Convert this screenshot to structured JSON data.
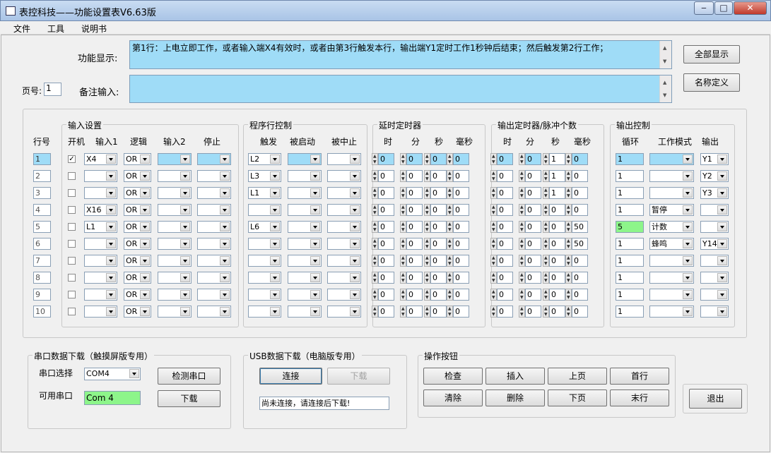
{
  "window": {
    "title": "表控科技——功能设置表V6.63版",
    "min": "‒",
    "max": "□",
    "close": "✕"
  },
  "menu": [
    "文件",
    "工具",
    "说明书"
  ],
  "function_label": "功能显示:",
  "function_text": "第1行：上电立即工作，或者输入端X4有效时，或者由第3行触发本行，输出端Y1定时工作1秒钟后结束；然后触发第2行工作；",
  "page_label": "页号:",
  "page_value": "1",
  "remark_label": "备注输入:",
  "remark_text": "",
  "buttons_right": {
    "show_all": "全部显示",
    "name_def": "名称定义",
    "exit": "退出"
  },
  "groups": {
    "input": "输入设置",
    "program": "程序行控制",
    "delay": "延时定时器",
    "out_timer": "输出定时器/脉冲个数",
    "output": "输出控制"
  },
  "headers": {
    "row": "行号",
    "input": [
      "开机",
      "输入1",
      "逻辑",
      "输入2",
      "停止"
    ],
    "program": [
      "触发",
      "被启动",
      "被中止"
    ],
    "delay": [
      "时",
      "分",
      "秒",
      "毫秒"
    ],
    "out_timer": [
      "时",
      "分",
      "秒",
      "毫秒"
    ],
    "output": [
      "循环",
      "工作模式",
      "输出"
    ]
  },
  "rows": [
    {
      "n": "1",
      "on": true,
      "in1": "X4",
      "logic": "OR",
      "in2": "",
      "stop": "",
      "trig": "L2",
      "started": "",
      "stopped": "",
      "delay": [
        "0",
        "0",
        "0",
        "0"
      ],
      "out": [
        "0",
        "0",
        "1",
        "0"
      ],
      "loop": "1",
      "mode": "",
      "output": "Y1"
    },
    {
      "n": "2",
      "on": false,
      "in1": "",
      "logic": "OR",
      "in2": "",
      "stop": "",
      "trig": "L3",
      "started": "",
      "stopped": "",
      "delay": [
        "0",
        "0",
        "0",
        "0"
      ],
      "out": [
        "0",
        "0",
        "1",
        "0"
      ],
      "loop": "1",
      "mode": "",
      "output": "Y2"
    },
    {
      "n": "3",
      "on": false,
      "in1": "",
      "logic": "OR",
      "in2": "",
      "stop": "",
      "trig": "L1",
      "started": "",
      "stopped": "",
      "delay": [
        "0",
        "0",
        "0",
        "0"
      ],
      "out": [
        "0",
        "0",
        "1",
        "0"
      ],
      "loop": "1",
      "mode": "",
      "output": "Y3"
    },
    {
      "n": "4",
      "on": false,
      "in1": "X16",
      "logic": "OR",
      "in2": "",
      "stop": "",
      "trig": "",
      "started": "",
      "stopped": "",
      "delay": [
        "0",
        "0",
        "0",
        "0"
      ],
      "out": [
        "0",
        "0",
        "0",
        "0"
      ],
      "loop": "1",
      "mode": "暂停",
      "output": ""
    },
    {
      "n": "5",
      "on": false,
      "in1": "L1",
      "logic": "OR",
      "in2": "",
      "stop": "",
      "trig": "L6",
      "started": "",
      "stopped": "",
      "delay": [
        "0",
        "0",
        "0",
        "0"
      ],
      "out": [
        "0",
        "0",
        "0",
        "50"
      ],
      "loop": "5",
      "mode": "计数",
      "output": ""
    },
    {
      "n": "6",
      "on": false,
      "in1": "",
      "logic": "OR",
      "in2": "",
      "stop": "",
      "trig": "",
      "started": "",
      "stopped": "",
      "delay": [
        "0",
        "0",
        "0",
        "0"
      ],
      "out": [
        "0",
        "0",
        "0",
        "50"
      ],
      "loop": "1",
      "mode": "蜂鸣",
      "output": "Y14"
    },
    {
      "n": "7",
      "on": false,
      "in1": "",
      "logic": "OR",
      "in2": "",
      "stop": "",
      "trig": "",
      "started": "",
      "stopped": "",
      "delay": [
        "0",
        "0",
        "0",
        "0"
      ],
      "out": [
        "0",
        "0",
        "0",
        "0"
      ],
      "loop": "1",
      "mode": "",
      "output": ""
    },
    {
      "n": "8",
      "on": false,
      "in1": "",
      "logic": "OR",
      "in2": "",
      "stop": "",
      "trig": "",
      "started": "",
      "stopped": "",
      "delay": [
        "0",
        "0",
        "0",
        "0"
      ],
      "out": [
        "0",
        "0",
        "0",
        "0"
      ],
      "loop": "1",
      "mode": "",
      "output": ""
    },
    {
      "n": "9",
      "on": false,
      "in1": "",
      "logic": "OR",
      "in2": "",
      "stop": "",
      "trig": "",
      "started": "",
      "stopped": "",
      "delay": [
        "0",
        "0",
        "0",
        "0"
      ],
      "out": [
        "0",
        "0",
        "0",
        "0"
      ],
      "loop": "1",
      "mode": "",
      "output": ""
    },
    {
      "n": "10",
      "on": false,
      "in1": "",
      "logic": "OR",
      "in2": "",
      "stop": "",
      "trig": "",
      "started": "",
      "stopped": "",
      "delay": [
        "0",
        "0",
        "0",
        "0"
      ],
      "out": [
        "0",
        "0",
        "0",
        "0"
      ],
      "loop": "1",
      "mode": "",
      "output": ""
    }
  ],
  "serial": {
    "title": "串口数据下载（触摸屏版专用）",
    "select_label": "串口选择",
    "select_value": "COM4",
    "avail_label": "可用串口",
    "avail_value": "Com 4",
    "detect": "检测串口",
    "download": "下载"
  },
  "usb": {
    "title": "USB数据下载（电脑版专用）",
    "connect": "连接",
    "download": "下载",
    "status": "尚未连接，请连接后下载!"
  },
  "ops": {
    "title": "操作按钮",
    "buttons": [
      "检查",
      "插入",
      "上页",
      "首行",
      "清除",
      "删除",
      "下页",
      "末行"
    ]
  }
}
